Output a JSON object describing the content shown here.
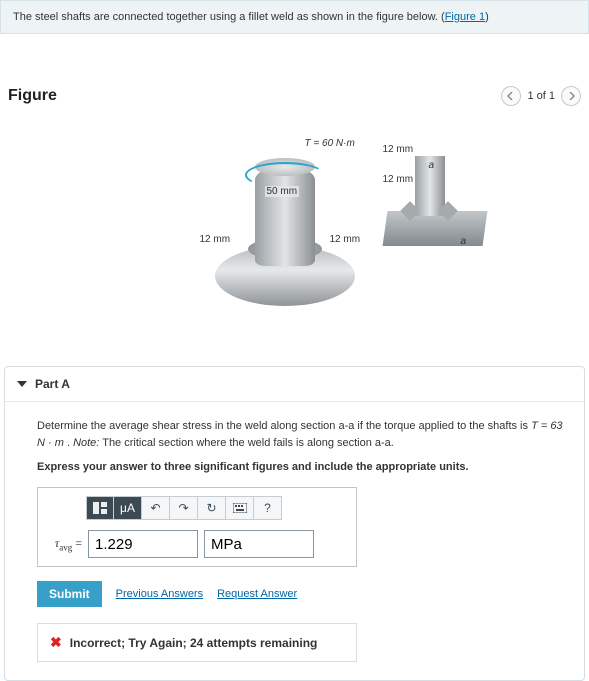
{
  "intro": {
    "text_before_link": "The steel shafts are connected together using a fillet weld as shown in the figure below. (",
    "link_text": "Figure 1",
    "text_after_link": ")"
  },
  "figure": {
    "heading": "Figure",
    "pager_text": "1 of 1",
    "labels": {
      "torque": "T = 60 N·m",
      "diameter": "50 mm",
      "leg_left": "12 mm",
      "leg_bottom": "12 mm",
      "detail_top": "12 mm",
      "detail_mid": "12 mm",
      "section_a1": "a",
      "section_a2": "a"
    }
  },
  "part": {
    "title": "Part A",
    "prompt_html_before_T": "Determine the average shear stress in the weld along section a-a if the torque applied to the shafts is ",
    "T_expr": "T = 63  N · m",
    "note_label": "Note:",
    "note_text": "The critical section where the weld fails is along section a-a.",
    "instruction": "Express your answer to three significant figures and include the appropriate units.",
    "toolbar": {
      "template": "template-icon",
      "units": "μA",
      "undo": "↶",
      "redo": "↷",
      "reset": "↻",
      "keyboard": "⌨",
      "help": "?"
    },
    "var_label": "τavg",
    "equals": "=",
    "value": "1.229",
    "unit": "MPa",
    "submit": "Submit",
    "prev_answers": "Previous Answers",
    "request_answer": "Request Answer",
    "feedback": "Incorrect; Try Again; 24 attempts remaining"
  }
}
